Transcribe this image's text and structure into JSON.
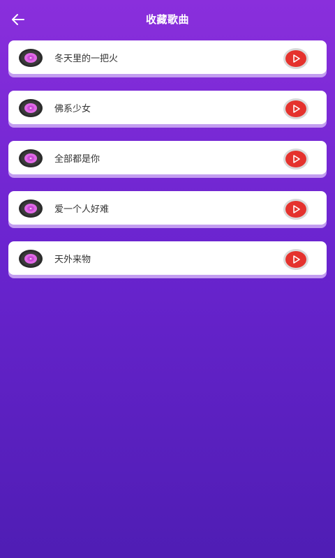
{
  "header": {
    "title": "收藏歌曲"
  },
  "songs": [
    {
      "title": "冬天里的一把火"
    },
    {
      "title": "佛系少女"
    },
    {
      "title": "全部都是你"
    },
    {
      "title": "爱一个人好难"
    },
    {
      "title": "天外来物"
    }
  ],
  "colors": {
    "background_top": "#8a2fdc",
    "background_bottom": "#4f1db4",
    "card": "#ffffff",
    "card_shadow": "#c39df0",
    "play_button": "#e5322d",
    "disc_center": "#e06ae6"
  },
  "icons": {
    "back": "arrow-left-icon",
    "disc": "vinyl-disc-icon",
    "play": "play-icon"
  }
}
